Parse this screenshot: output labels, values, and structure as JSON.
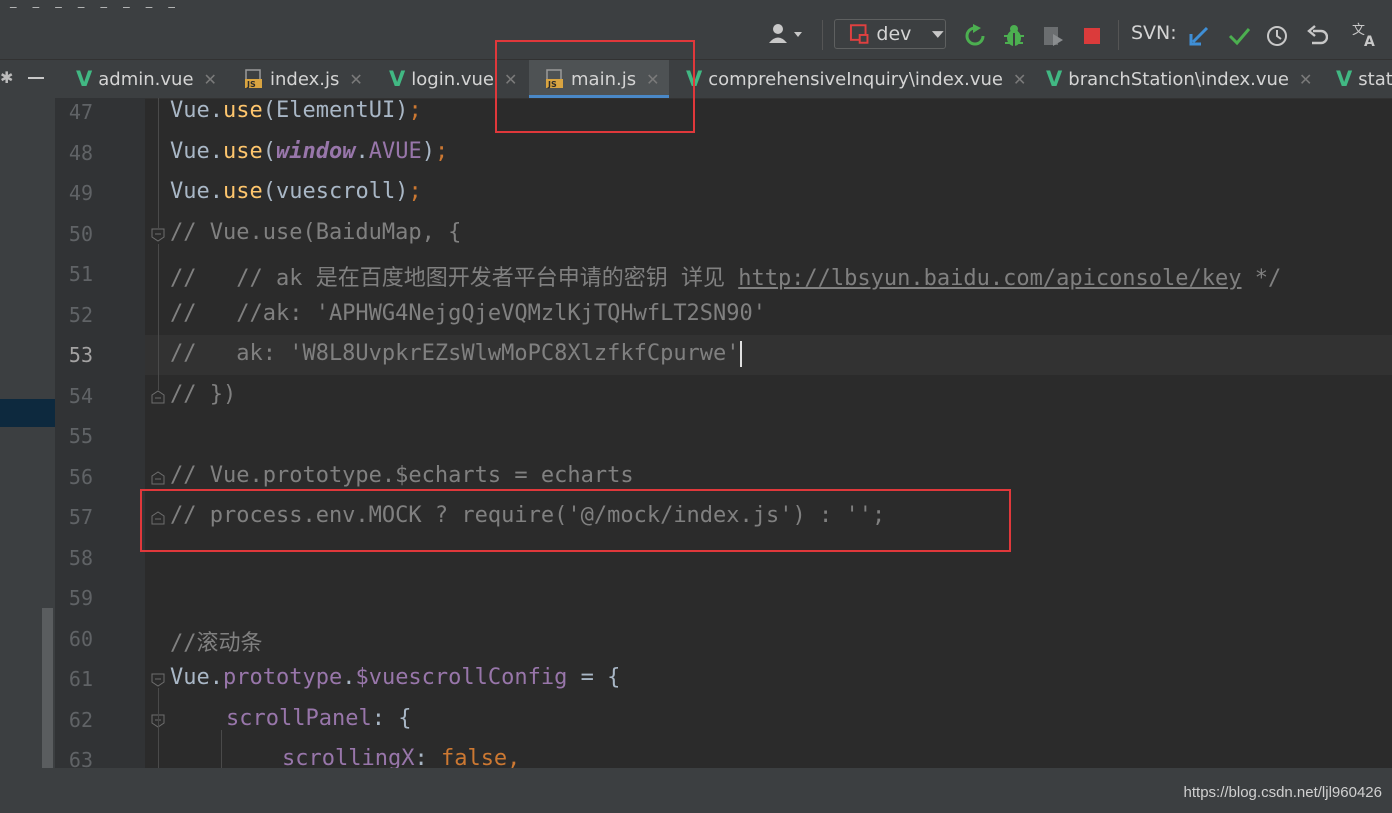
{
  "toolbar": {
    "branch": "dev",
    "svn_label": "SVN:",
    "icons": [
      "user-icon",
      "run-icon",
      "debug-icon",
      "coverage-icon",
      "stop-icon",
      "svn-update-icon",
      "svn-commit-icon",
      "history-icon",
      "revert-icon",
      "translate-icon"
    ]
  },
  "tabs": [
    {
      "name": "admin.vue",
      "type": "vue"
    },
    {
      "name": "index.js",
      "type": "js"
    },
    {
      "name": "login.vue",
      "type": "vue"
    },
    {
      "name": "main.js",
      "type": "js",
      "active": true
    },
    {
      "name": "comprehensiveInquiry\\index.vue",
      "type": "vue"
    },
    {
      "name": "branchStation\\index.vue",
      "type": "vue"
    },
    {
      "name": "stat",
      "type": "vue"
    }
  ],
  "editor": {
    "current_line": "53",
    "lines": [
      {
        "no": "47",
        "text": "Vue.use(ElementUI);"
      },
      {
        "no": "48",
        "text": "Vue.use(window.AVUE);"
      },
      {
        "no": "49",
        "text": "Vue.use(vuescroll);"
      },
      {
        "no": "50",
        "text": "// Vue.use(BaiduMap, {"
      },
      {
        "no": "51",
        "text": "//   // ak 是在百度地图开发者平台申请的密钥 详见 ",
        "link": "http://lbsyun.baidu.com/apiconsole/key",
        "tail": " */"
      },
      {
        "no": "52",
        "text": "//   //ak: 'APHWG4NejgQjeVQMzlKjTQHwfLT2SN90'"
      },
      {
        "no": "53",
        "text": "//   ak: 'W8L8UvpkrEZsWlwMoPC8XlzfkfCpurwe'"
      },
      {
        "no": "54",
        "text": "// })"
      },
      {
        "no": "55",
        "text": ""
      },
      {
        "no": "56",
        "text": "// Vue.prototype.$echarts = echarts"
      },
      {
        "no": "57",
        "text": "// process.env.MOCK ? require('@/mock/index.js') : '';"
      },
      {
        "no": "58",
        "text": ""
      },
      {
        "no": "59",
        "text": ""
      },
      {
        "no": "60",
        "text": "//滚动条"
      },
      {
        "no": "61",
        "text": "Vue.prototype.$vuescrollConfig = {"
      },
      {
        "no": "62",
        "text": "scrollPanel: {"
      },
      {
        "no": "63",
        "text": "scrollingX: false,"
      }
    ]
  },
  "watermark": "https://blog.csdn.net/ljl960426"
}
